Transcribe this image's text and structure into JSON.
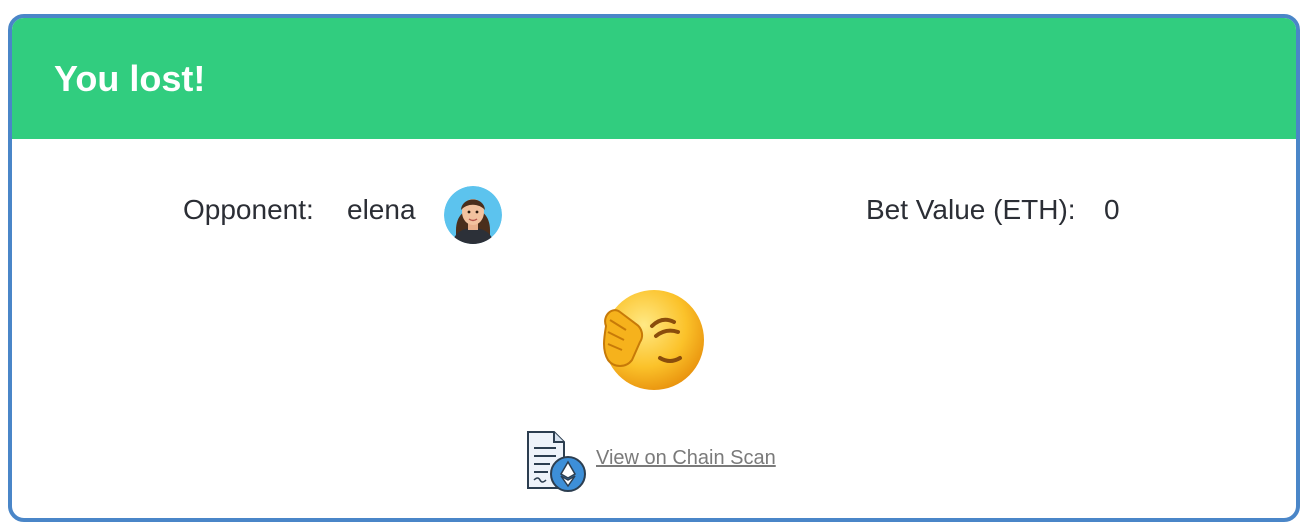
{
  "dialog": {
    "title": "You lost!",
    "header_color": "#31cd7f",
    "border_color": "#4a86c8"
  },
  "opponent": {
    "label": "Opponent:",
    "name": "elena",
    "avatar_icon": "woman-avatar-icon"
  },
  "bet": {
    "label": "Bet Value (ETH):",
    "value": "0"
  },
  "result_icon": "facepalm-emoji-icon",
  "chain_scan": {
    "icon": "ethereum-document-icon",
    "link_label": "View on Chain Scan"
  }
}
